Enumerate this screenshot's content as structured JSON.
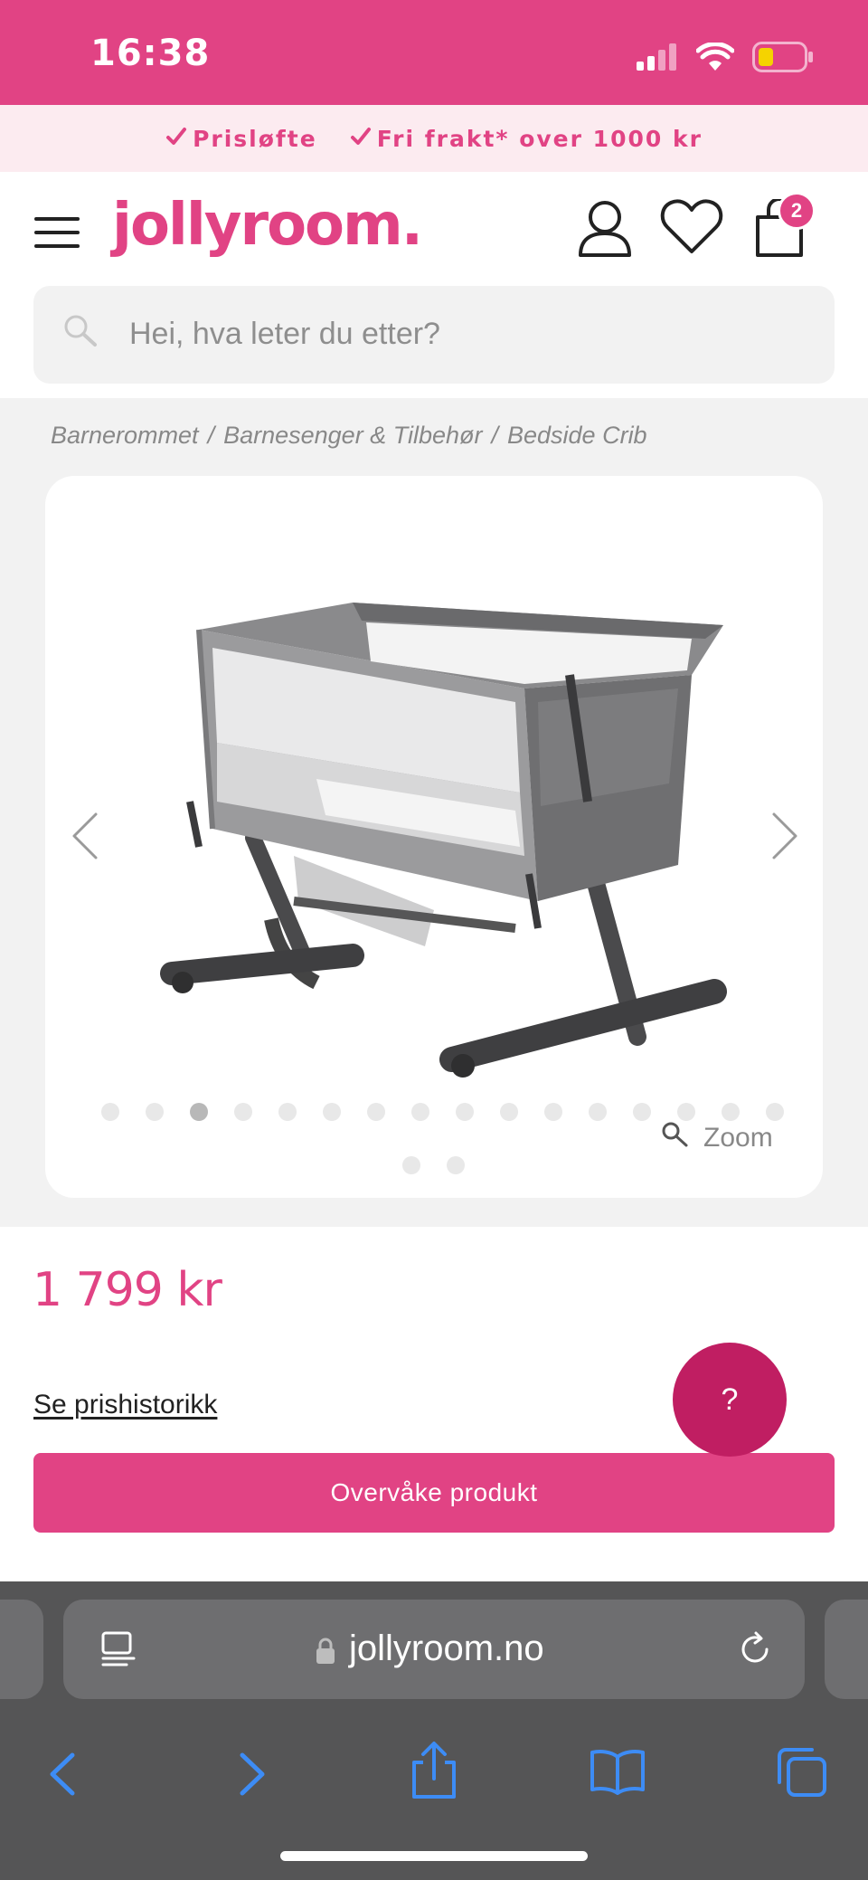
{
  "status_bar": {
    "time": "16:38",
    "icons": [
      "cellular-signal-icon",
      "wifi-icon",
      "battery-icon"
    ],
    "color": "#e14384"
  },
  "promo": {
    "items": [
      "Prisløfte",
      "Fri frakt* over 1000 kr"
    ]
  },
  "header": {
    "logo": "jollyroom.",
    "cart_count": "2",
    "icons": [
      "menu-icon",
      "account-icon",
      "heart-icon",
      "cart-icon"
    ]
  },
  "search": {
    "placeholder": "Hei, hva leter du etter?"
  },
  "breadcrumb": {
    "items": [
      "Barnerommet",
      "Barnesenger & Tilbehør",
      "Bedside Crib"
    ],
    "separator": "/"
  },
  "gallery": {
    "image_name": "bedside-crib-grey",
    "total_slides": 18,
    "active_slide": 3,
    "zoom_label": "Zoom"
  },
  "product": {
    "price": "1 799 kr",
    "history_link": "Se prishistorikk",
    "watch_button": "Overvåke produkt",
    "help_button": "?"
  },
  "browser": {
    "url": "jollyroom.no",
    "toolbar_icons": [
      "back-icon",
      "forward-icon",
      "share-icon",
      "bookmarks-icon",
      "tabs-icon"
    ]
  },
  "colors": {
    "brand": "#e14384",
    "help": "#c01e62",
    "browser_bg": "#555556",
    "toolbar_icon": "#3d8cf5"
  }
}
